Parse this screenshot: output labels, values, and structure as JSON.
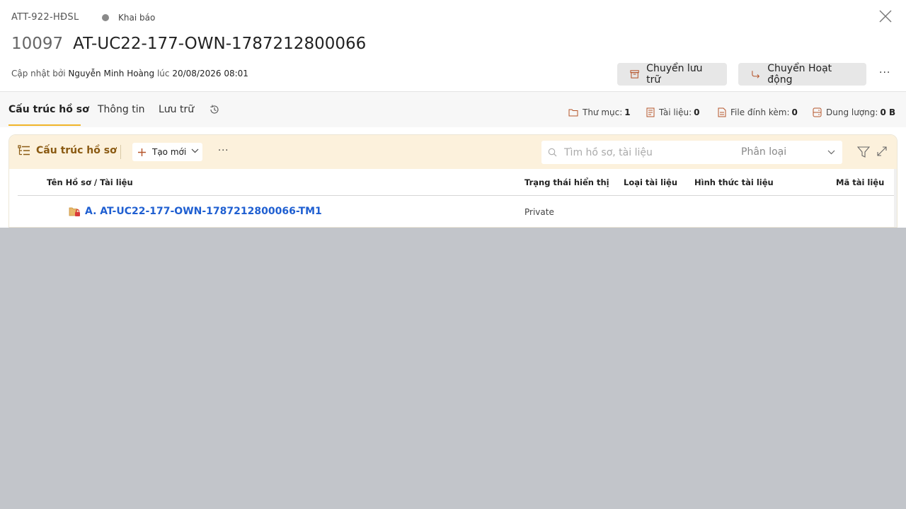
{
  "header": {
    "code": "ATT-922-HĐSL",
    "status": "Khai báo",
    "record_number": "10097",
    "record_name": "AT-UC22-177-OWN-1787212800066",
    "updated_prefix": "Cập nhật bởi",
    "updated_by": "Nguyễn Minh Hoàng",
    "updated_at_prefix": "lúc",
    "updated_at": "20/08/2026 08:01",
    "archive_button": "Chuyển lưu trữ",
    "activate_button": "Chuyển Hoạt động",
    "more": "···"
  },
  "tabs": [
    {
      "label": "Cấu trúc hồ sơ",
      "active": true
    },
    {
      "label": "Thông tin",
      "active": false
    },
    {
      "label": "Lưu trữ",
      "active": false
    }
  ],
  "stats": {
    "folders_label": "Thư mục:",
    "folders_value": "1",
    "documents_label": "Tài liệu:",
    "documents_value": "0",
    "attachments_label": "File đính kèm:",
    "attachments_value": "0",
    "size_label": "Dung lượng:",
    "size_value": "0 B"
  },
  "toolbar": {
    "title": "Cấu trúc hồ sơ",
    "create_label": "Tạo mới",
    "more": "···",
    "search_placeholder": "Tìm hồ sơ, tài liệu",
    "classify_label": "Phân loại"
  },
  "table": {
    "columns": [
      "Tên Hồ sơ / Tài liệu",
      "Trạng thái hiển thị",
      "Loại tài liệu",
      "Hình thức tài liệu",
      "Mã tài liệu"
    ],
    "rows": [
      {
        "name": "A. AT-UC22-177-OWN-1787212800066-TM1",
        "visibility": "Private",
        "doc_type": "",
        "doc_form": "",
        "doc_code": ""
      }
    ]
  },
  "colors": {
    "accent": "#f0b429",
    "toolbar_bg": "#fcf1dc",
    "toolbar_text": "#8a5a12",
    "link": "#1f5fd1",
    "overlay": "#c2c5ca"
  },
  "icons": [
    "close-icon",
    "archive-box-icon",
    "redirect-arrow-icon",
    "history-icon",
    "folder-icon",
    "document-icon",
    "attachment-file-icon",
    "storage-icon",
    "tree-list-icon",
    "plus-icon",
    "chevron-down-icon",
    "search-icon",
    "filter-icon",
    "expand-icon",
    "locked-folder-icon"
  ]
}
